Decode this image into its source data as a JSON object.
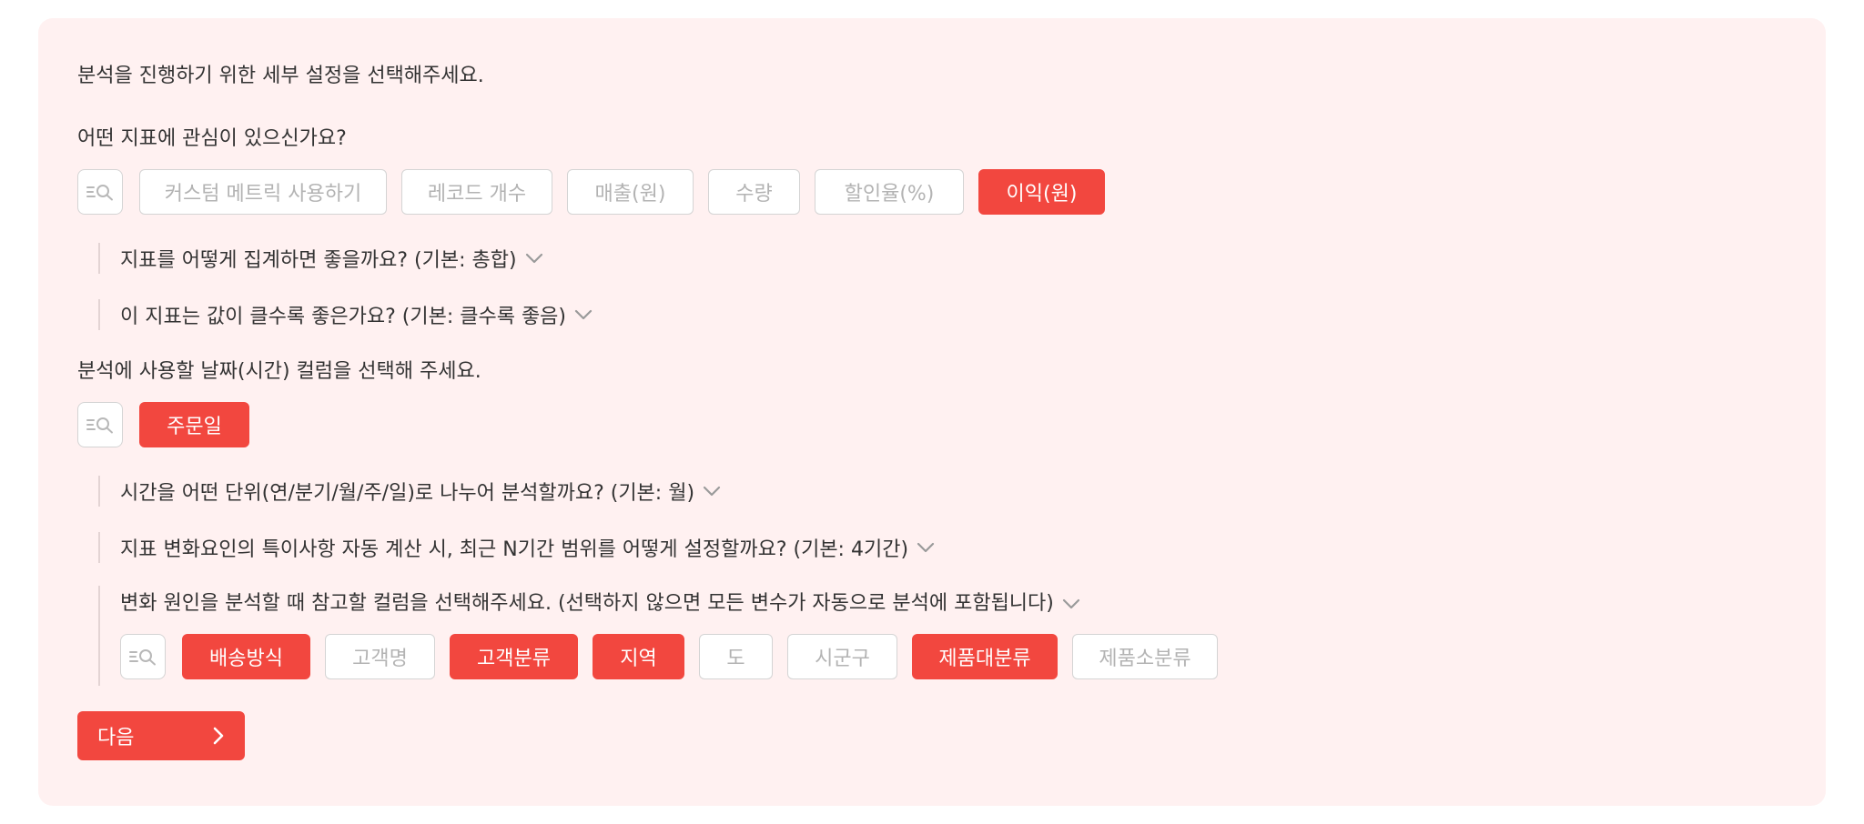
{
  "intro": "분석을 진행하기 위한 세부 설정을 선택해주세요.",
  "metric": {
    "question": "어떤 지표에 관심이 있으신가요?",
    "search_icon": "search-list-icon",
    "options": [
      {
        "label": "커스텀 메트릭 사용하기",
        "selected": false
      },
      {
        "label": "레코드 개수",
        "selected": false
      },
      {
        "label": "매출(원)",
        "selected": false
      },
      {
        "label": "수량",
        "selected": false
      },
      {
        "label": "할인율(%)",
        "selected": false
      },
      {
        "label": "이익(원)",
        "selected": true
      }
    ],
    "aggregation": "지표를 어떻게 집계하면 좋을까요? (기본: 총합)",
    "direction": "이 지표는 값이 클수록 좋은가요? (기본: 클수록 좋음)"
  },
  "date": {
    "question": "분석에 사용할 날짜(시간) 컬럼을 선택해 주세요.",
    "options": [
      {
        "label": "주문일",
        "selected": true
      }
    ],
    "unit": "시간을 어떤 단위(연/분기/월/주/일)로 나누어 분석할까요? (기본: 월)",
    "range": "지표 변화요인의 특이사항 자동 계산 시, 최근 N기간 범위를 어떻게 설정할까요? (기본: 4기간)"
  },
  "causes": {
    "question": "변화 원인을 분석할 때 참고할 컬럼을 선택해주세요. (선택하지 않으면 모든 변수가 자동으로 분석에 포함됩니다)",
    "options": [
      {
        "label": "배송방식",
        "selected": true
      },
      {
        "label": "고객명",
        "selected": false
      },
      {
        "label": "고객분류",
        "selected": true
      },
      {
        "label": "지역",
        "selected": true
      },
      {
        "label": "도",
        "selected": false
      },
      {
        "label": "시군구",
        "selected": false
      },
      {
        "label": "제품대분류",
        "selected": true
      },
      {
        "label": "제품소분류",
        "selected": false
      }
    ]
  },
  "next_label": "다음",
  "colors": {
    "accent": "#f2473f",
    "panel_bg": "#fff1f1",
    "chip_border": "#d4d4d4",
    "chip_text": "#b3b3b3"
  }
}
